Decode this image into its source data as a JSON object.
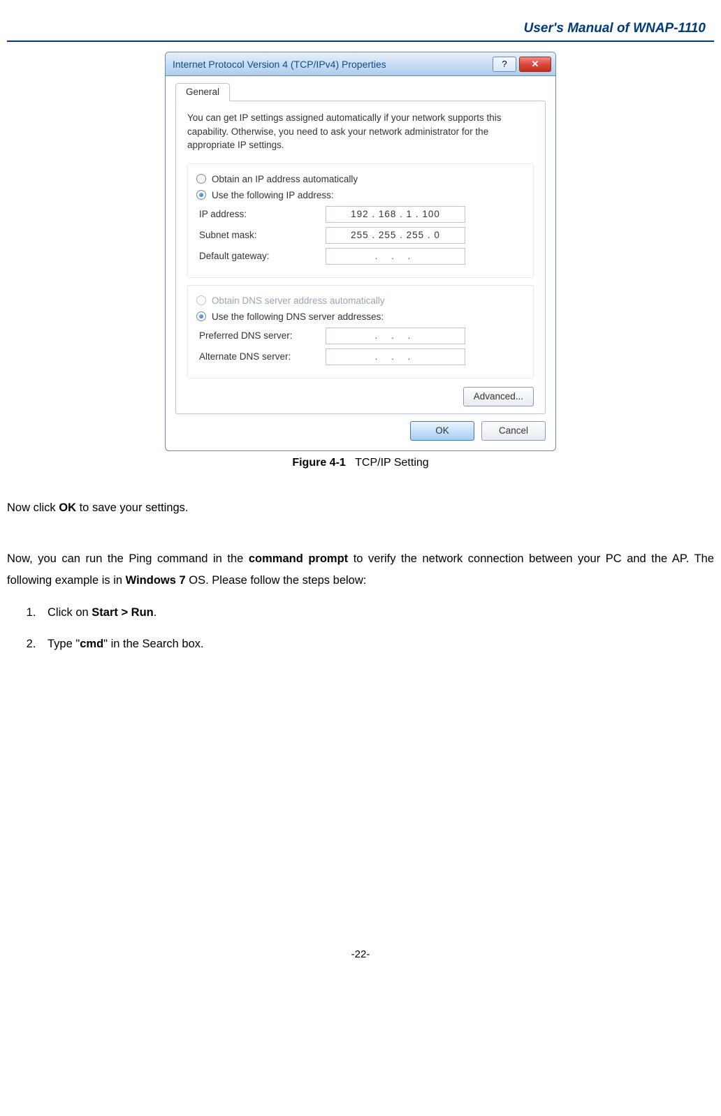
{
  "header": {
    "title": "User's  Manual  of  WNAP-1110"
  },
  "dialog": {
    "title": "Internet Protocol Version 4 (TCP/IPv4) Properties",
    "help_icon": "?",
    "close_icon": "✕",
    "tab": "General",
    "description": "You can get IP settings assigned automatically if your network supports this capability. Otherwise, you need to ask your network administrator for the appropriate IP settings.",
    "ip_group": {
      "auto_label": "Obtain an IP address automatically",
      "manual_label": "Use the following IP address:",
      "ip_label": "IP address:",
      "ip_value": "192 . 168 .   1   . 100",
      "subnet_label": "Subnet mask:",
      "subnet_value": "255 . 255 . 255 .   0",
      "gateway_label": "Default gateway:",
      "gateway_value": ".       .       ."
    },
    "dns_group": {
      "auto_label": "Obtain DNS server address automatically",
      "manual_label": "Use the following DNS server addresses:",
      "pref_label": "Preferred DNS server:",
      "pref_value": ".       .       .",
      "alt_label": "Alternate DNS server:",
      "alt_value": ".       .       ."
    },
    "advanced_label": "Advanced...",
    "ok_label": "OK",
    "cancel_label": "Cancel"
  },
  "caption": {
    "figure_no": "Figure 4-1",
    "figure_title": "TCP/IP Setting"
  },
  "body": {
    "p1_pre": "Now click ",
    "p1_b": "OK",
    "p1_post": " to save your settings.",
    "p2_pre": "Now, you can run the Ping command in the ",
    "p2_b1": "command prompt",
    "p2_mid": " to verify the network connection between your PC and the AP. The following example is in ",
    "p2_b2": "Windows 7",
    "p2_post": " OS. Please follow the steps below:"
  },
  "steps": {
    "s1_pre": "Click on ",
    "s1_b": "Start > Run",
    "s1_post": ".",
    "s2_pre": "Type \"",
    "s2_b": "cmd",
    "s2_post": "\" in the Search box."
  },
  "footer": {
    "page_no": "-22-"
  }
}
